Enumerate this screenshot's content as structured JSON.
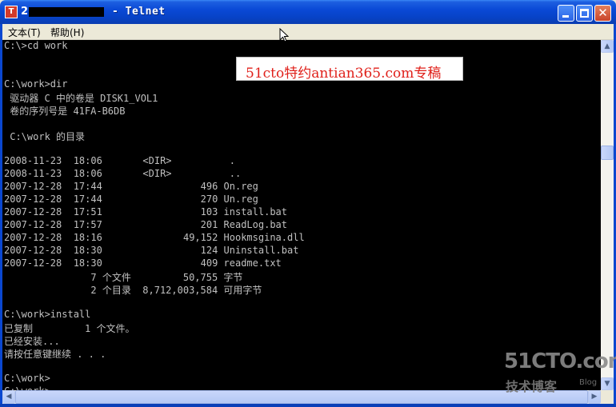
{
  "window": {
    "title_prefix": "2",
    "title": "- Telnet",
    "controls": {
      "minimize": "minimize",
      "maximize": "maximize",
      "close": "✕"
    }
  },
  "menu": [
    {
      "label": "文本(T)"
    },
    {
      "label": "帮助(H)"
    }
  ],
  "console": {
    "lines": [
      "C:\\>cd work",
      "",
      "",
      "C:\\work>dir",
      " 驱动器 C 中的卷是 DISK1_VOL1",
      " 卷的序列号是 41FA-B6DB",
      "",
      " C:\\work 的目录",
      "",
      "2008-11-23  18:06       <DIR>          .",
      "2008-11-23  18:06       <DIR>          ..",
      "2007-12-28  17:44                 496 On.reg",
      "2007-12-28  17:44                 270 Un.reg",
      "2007-12-28  17:51                 103 install.bat",
      "2007-12-28  17:57                 201 ReadLog.bat",
      "2007-12-28  18:16              49,152 Hookmsgina.dll",
      "2007-12-28  18:30                 124 Uninstall.bat",
      "2007-12-28  18:30                 409 readme.txt",
      "               7 个文件         50,755 字节",
      "               2 个目录  8,712,003,584 可用字节",
      "",
      "C:\\work>install",
      "已复制         1 个文件。",
      "已经安装...",
      "请按任意键继续 . . .",
      "",
      "C:\\work>",
      "C:\\work>"
    ]
  },
  "overlay": {
    "banner": "51cto特约antian365.com专稿",
    "logo_main": "51CTO.com",
    "logo_sub": "技术博客",
    "logo_blog": "Blog"
  },
  "colors": {
    "console_bg": "#000000",
    "console_fg": "#c0c0c0",
    "titlebar": "#0a49d6",
    "banner_text": "#e0201a"
  }
}
